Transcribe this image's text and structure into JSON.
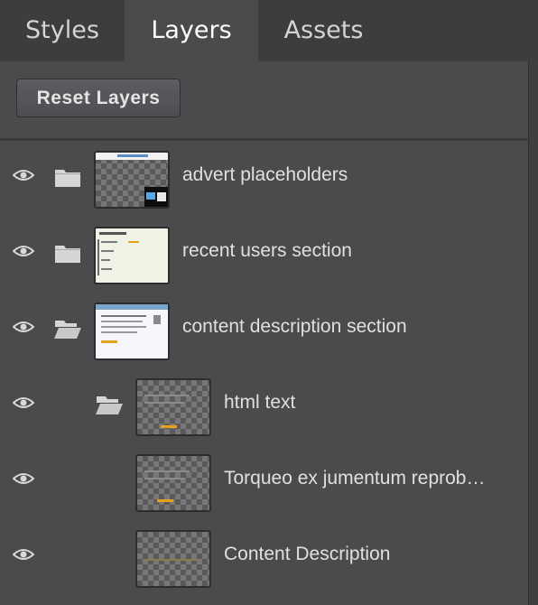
{
  "tabs": [
    {
      "label": "Styles",
      "active": false
    },
    {
      "label": "Layers",
      "active": true
    },
    {
      "label": "Assets",
      "active": false
    }
  ],
  "reset_button": {
    "label": "Reset Layers"
  },
  "layers": [
    {
      "name": "advert placeholders",
      "visible": true,
      "type": "folder-closed",
      "depth": 0
    },
    {
      "name": "recent users section",
      "visible": true,
      "type": "folder-closed",
      "depth": 0
    },
    {
      "name": "content description section",
      "visible": true,
      "type": "folder-open",
      "depth": 0
    },
    {
      "name": "html text",
      "visible": true,
      "type": "folder-open",
      "depth": 1
    },
    {
      "name": "Torqueo ex jumentum reprob…",
      "visible": true,
      "type": "item",
      "depth": 2
    },
    {
      "name": "Content Description",
      "visible": true,
      "type": "item",
      "depth": 2
    }
  ],
  "colors": {
    "panel_bg": "#4a4b4d",
    "tabbar_bg": "#3c3d3f",
    "accent_thumb": "#e8a020"
  }
}
